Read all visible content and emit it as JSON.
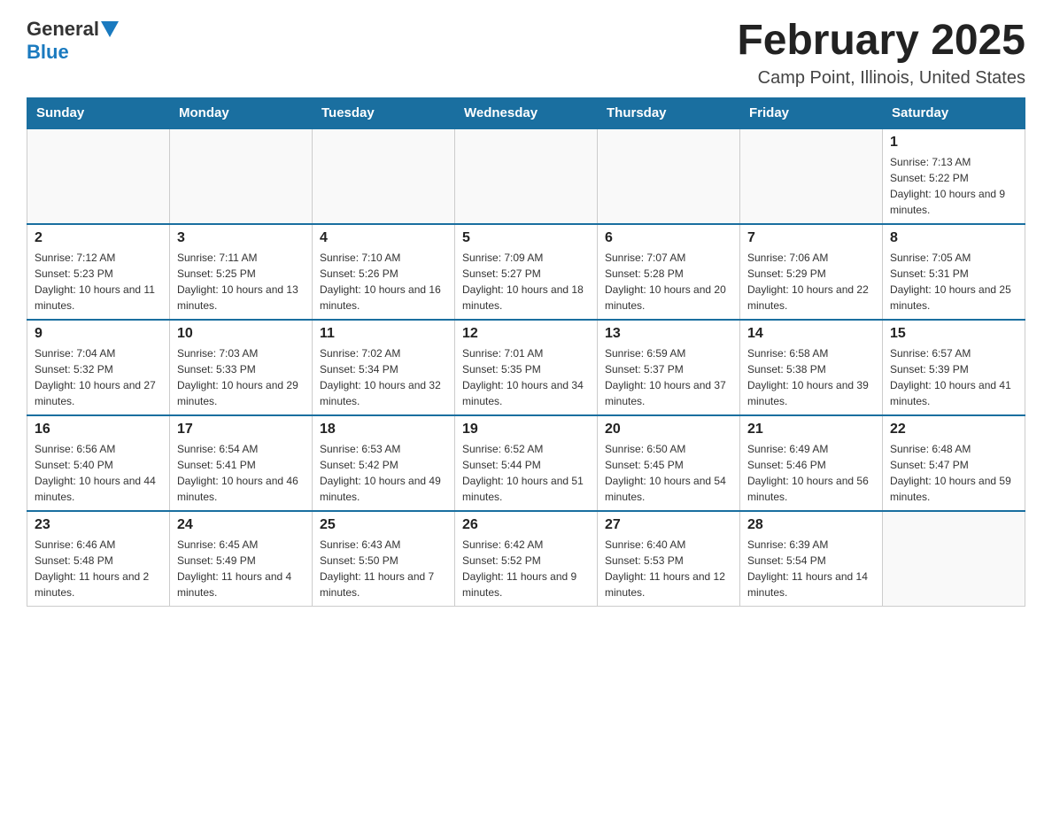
{
  "header": {
    "logo_general": "General",
    "logo_blue": "Blue",
    "month_title": "February 2025",
    "location": "Camp Point, Illinois, United States"
  },
  "days_of_week": [
    "Sunday",
    "Monday",
    "Tuesday",
    "Wednesday",
    "Thursday",
    "Friday",
    "Saturday"
  ],
  "weeks": [
    [
      {
        "day": "",
        "sunrise": "",
        "sunset": "",
        "daylight": ""
      },
      {
        "day": "",
        "sunrise": "",
        "sunset": "",
        "daylight": ""
      },
      {
        "day": "",
        "sunrise": "",
        "sunset": "",
        "daylight": ""
      },
      {
        "day": "",
        "sunrise": "",
        "sunset": "",
        "daylight": ""
      },
      {
        "day": "",
        "sunrise": "",
        "sunset": "",
        "daylight": ""
      },
      {
        "day": "",
        "sunrise": "",
        "sunset": "",
        "daylight": ""
      },
      {
        "day": "1",
        "sunrise": "Sunrise: 7:13 AM",
        "sunset": "Sunset: 5:22 PM",
        "daylight": "Daylight: 10 hours and 9 minutes."
      }
    ],
    [
      {
        "day": "2",
        "sunrise": "Sunrise: 7:12 AM",
        "sunset": "Sunset: 5:23 PM",
        "daylight": "Daylight: 10 hours and 11 minutes."
      },
      {
        "day": "3",
        "sunrise": "Sunrise: 7:11 AM",
        "sunset": "Sunset: 5:25 PM",
        "daylight": "Daylight: 10 hours and 13 minutes."
      },
      {
        "day": "4",
        "sunrise": "Sunrise: 7:10 AM",
        "sunset": "Sunset: 5:26 PM",
        "daylight": "Daylight: 10 hours and 16 minutes."
      },
      {
        "day": "5",
        "sunrise": "Sunrise: 7:09 AM",
        "sunset": "Sunset: 5:27 PM",
        "daylight": "Daylight: 10 hours and 18 minutes."
      },
      {
        "day": "6",
        "sunrise": "Sunrise: 7:07 AM",
        "sunset": "Sunset: 5:28 PM",
        "daylight": "Daylight: 10 hours and 20 minutes."
      },
      {
        "day": "7",
        "sunrise": "Sunrise: 7:06 AM",
        "sunset": "Sunset: 5:29 PM",
        "daylight": "Daylight: 10 hours and 22 minutes."
      },
      {
        "day": "8",
        "sunrise": "Sunrise: 7:05 AM",
        "sunset": "Sunset: 5:31 PM",
        "daylight": "Daylight: 10 hours and 25 minutes."
      }
    ],
    [
      {
        "day": "9",
        "sunrise": "Sunrise: 7:04 AM",
        "sunset": "Sunset: 5:32 PM",
        "daylight": "Daylight: 10 hours and 27 minutes."
      },
      {
        "day": "10",
        "sunrise": "Sunrise: 7:03 AM",
        "sunset": "Sunset: 5:33 PM",
        "daylight": "Daylight: 10 hours and 29 minutes."
      },
      {
        "day": "11",
        "sunrise": "Sunrise: 7:02 AM",
        "sunset": "Sunset: 5:34 PM",
        "daylight": "Daylight: 10 hours and 32 minutes."
      },
      {
        "day": "12",
        "sunrise": "Sunrise: 7:01 AM",
        "sunset": "Sunset: 5:35 PM",
        "daylight": "Daylight: 10 hours and 34 minutes."
      },
      {
        "day": "13",
        "sunrise": "Sunrise: 6:59 AM",
        "sunset": "Sunset: 5:37 PM",
        "daylight": "Daylight: 10 hours and 37 minutes."
      },
      {
        "day": "14",
        "sunrise": "Sunrise: 6:58 AM",
        "sunset": "Sunset: 5:38 PM",
        "daylight": "Daylight: 10 hours and 39 minutes."
      },
      {
        "day": "15",
        "sunrise": "Sunrise: 6:57 AM",
        "sunset": "Sunset: 5:39 PM",
        "daylight": "Daylight: 10 hours and 41 minutes."
      }
    ],
    [
      {
        "day": "16",
        "sunrise": "Sunrise: 6:56 AM",
        "sunset": "Sunset: 5:40 PM",
        "daylight": "Daylight: 10 hours and 44 minutes."
      },
      {
        "day": "17",
        "sunrise": "Sunrise: 6:54 AM",
        "sunset": "Sunset: 5:41 PM",
        "daylight": "Daylight: 10 hours and 46 minutes."
      },
      {
        "day": "18",
        "sunrise": "Sunrise: 6:53 AM",
        "sunset": "Sunset: 5:42 PM",
        "daylight": "Daylight: 10 hours and 49 minutes."
      },
      {
        "day": "19",
        "sunrise": "Sunrise: 6:52 AM",
        "sunset": "Sunset: 5:44 PM",
        "daylight": "Daylight: 10 hours and 51 minutes."
      },
      {
        "day": "20",
        "sunrise": "Sunrise: 6:50 AM",
        "sunset": "Sunset: 5:45 PM",
        "daylight": "Daylight: 10 hours and 54 minutes."
      },
      {
        "day": "21",
        "sunrise": "Sunrise: 6:49 AM",
        "sunset": "Sunset: 5:46 PM",
        "daylight": "Daylight: 10 hours and 56 minutes."
      },
      {
        "day": "22",
        "sunrise": "Sunrise: 6:48 AM",
        "sunset": "Sunset: 5:47 PM",
        "daylight": "Daylight: 10 hours and 59 minutes."
      }
    ],
    [
      {
        "day": "23",
        "sunrise": "Sunrise: 6:46 AM",
        "sunset": "Sunset: 5:48 PM",
        "daylight": "Daylight: 11 hours and 2 minutes."
      },
      {
        "day": "24",
        "sunrise": "Sunrise: 6:45 AM",
        "sunset": "Sunset: 5:49 PM",
        "daylight": "Daylight: 11 hours and 4 minutes."
      },
      {
        "day": "25",
        "sunrise": "Sunrise: 6:43 AM",
        "sunset": "Sunset: 5:50 PM",
        "daylight": "Daylight: 11 hours and 7 minutes."
      },
      {
        "day": "26",
        "sunrise": "Sunrise: 6:42 AM",
        "sunset": "Sunset: 5:52 PM",
        "daylight": "Daylight: 11 hours and 9 minutes."
      },
      {
        "day": "27",
        "sunrise": "Sunrise: 6:40 AM",
        "sunset": "Sunset: 5:53 PM",
        "daylight": "Daylight: 11 hours and 12 minutes."
      },
      {
        "day": "28",
        "sunrise": "Sunrise: 6:39 AM",
        "sunset": "Sunset: 5:54 PM",
        "daylight": "Daylight: 11 hours and 14 minutes."
      },
      {
        "day": "",
        "sunrise": "",
        "sunset": "",
        "daylight": ""
      }
    ]
  ]
}
